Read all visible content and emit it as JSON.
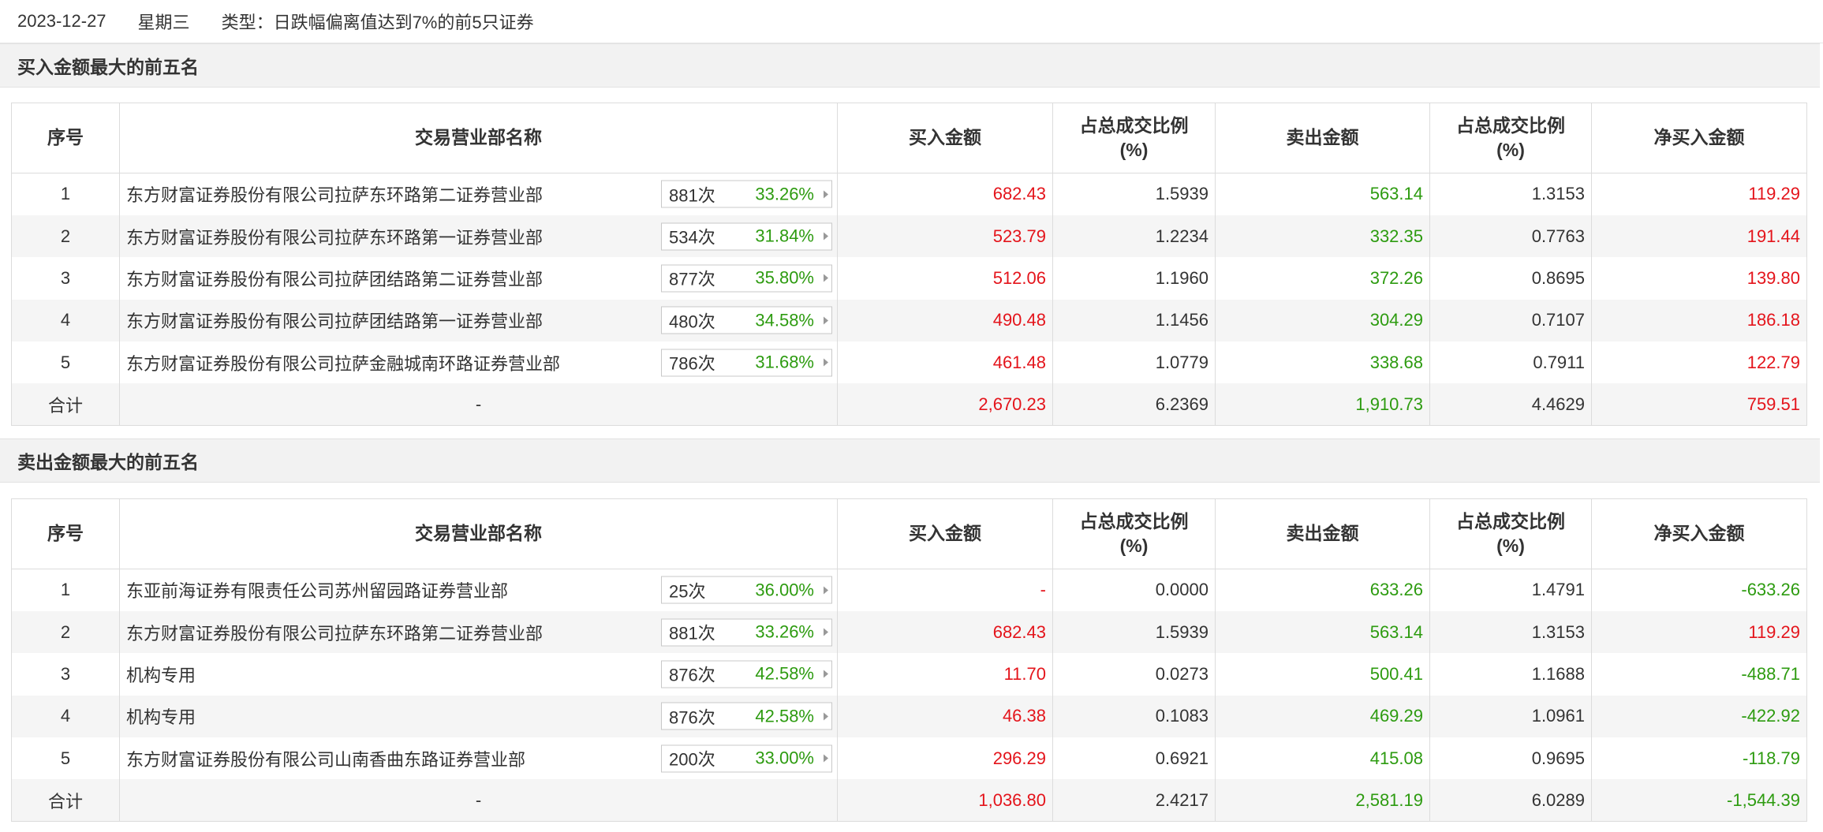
{
  "header": {
    "date": "2023-12-27",
    "weekday": "星期三",
    "type": "类型：日跌幅偏离值达到7%的前5只证券"
  },
  "columns": [
    "序号",
    "交易营业部名称",
    "买入金额",
    "占总成交比例\n(%)",
    "卖出金额",
    "占总成交比例\n(%)",
    "净买入金额"
  ],
  "buy_section": {
    "title": "买入金额最大的前五名",
    "rows": [
      {
        "idx": "1",
        "name": "东方财富证券股份有限公司拉萨东环路第二证券营业部",
        "times": "881次",
        "pct": "33.26%",
        "buy": "682.43",
        "buy_pct": "1.5939",
        "sell": "563.14",
        "sell_pct": "1.3153",
        "net": "119.29"
      },
      {
        "idx": "2",
        "name": "东方财富证券股份有限公司拉萨东环路第一证券营业部",
        "times": "534次",
        "pct": "31.84%",
        "buy": "523.79",
        "buy_pct": "1.2234",
        "sell": "332.35",
        "sell_pct": "0.7763",
        "net": "191.44"
      },
      {
        "idx": "3",
        "name": "东方财富证券股份有限公司拉萨团结路第二证券营业部",
        "times": "877次",
        "pct": "35.80%",
        "buy": "512.06",
        "buy_pct": "1.1960",
        "sell": "372.26",
        "sell_pct": "0.8695",
        "net": "139.80"
      },
      {
        "idx": "4",
        "name": "东方财富证券股份有限公司拉萨团结路第一证券营业部",
        "times": "480次",
        "pct": "34.58%",
        "buy": "490.48",
        "buy_pct": "1.1456",
        "sell": "304.29",
        "sell_pct": "0.7107",
        "net": "186.18"
      },
      {
        "idx": "5",
        "name": "东方财富证券股份有限公司拉萨金融城南环路证券营业部",
        "times": "786次",
        "pct": "31.68%",
        "buy": "461.48",
        "buy_pct": "1.0779",
        "sell": "338.68",
        "sell_pct": "0.7911",
        "net": "122.79"
      }
    ],
    "total": {
      "label": "合计",
      "name": "-",
      "buy": "2,670.23",
      "buy_pct": "6.2369",
      "sell": "1,910.73",
      "sell_pct": "4.4629",
      "net": "759.51"
    }
  },
  "sell_section": {
    "title": "卖出金额最大的前五名",
    "rows": [
      {
        "idx": "1",
        "name": "东亚前海证券有限责任公司苏州留园路证券营业部",
        "times": "25次",
        "pct": "36.00%",
        "buy": "-",
        "buy_pct": "0.0000",
        "sell": "633.26",
        "sell_pct": "1.4791",
        "net": "-633.26"
      },
      {
        "idx": "2",
        "name": "东方财富证券股份有限公司拉萨东环路第二证券营业部",
        "times": "881次",
        "pct": "33.26%",
        "buy": "682.43",
        "buy_pct": "1.5939",
        "sell": "563.14",
        "sell_pct": "1.3153",
        "net": "119.29"
      },
      {
        "idx": "3",
        "name": "机构专用",
        "times": "876次",
        "pct": "42.58%",
        "buy": "11.70",
        "buy_pct": "0.0273",
        "sell": "500.41",
        "sell_pct": "1.1688",
        "net": "-488.71"
      },
      {
        "idx": "4",
        "name": "机构专用",
        "times": "876次",
        "pct": "42.58%",
        "buy": "46.38",
        "buy_pct": "0.1083",
        "sell": "469.29",
        "sell_pct": "1.0961",
        "net": "-422.92"
      },
      {
        "idx": "5",
        "name": "东方财富证券股份有限公司山南香曲东路证券营业部",
        "times": "200次",
        "pct": "33.00%",
        "buy": "296.29",
        "buy_pct": "0.6921",
        "sell": "415.08",
        "sell_pct": "0.9695",
        "net": "-118.79"
      }
    ],
    "total": {
      "label": "合计",
      "name": "-",
      "buy": "1,036.80",
      "buy_pct": "2.4217",
      "sell": "2,581.19",
      "sell_pct": "6.0289",
      "net": "-1,544.39"
    }
  },
  "colors": {
    "red": "#e4141b",
    "green": "#2d9b10",
    "header_bg": "#f2f2f2",
    "stripe_bg": "#f5f5f5"
  }
}
